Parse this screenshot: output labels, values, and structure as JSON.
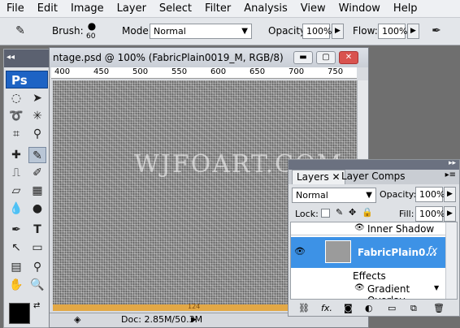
{
  "menu": [
    "File",
    "Edit",
    "Image",
    "Layer",
    "Select",
    "Filter",
    "Analysis",
    "View",
    "Window",
    "Help"
  ],
  "options": {
    "brush_label": "Brush:",
    "brush_size": "60",
    "mode_label": "Mode:",
    "mode_value": "Normal",
    "opacity_label": "Opacity:",
    "opacity_value": "100%",
    "flow_label": "Flow:",
    "flow_value": "100%"
  },
  "toolbox": {
    "logo": "Ps"
  },
  "document": {
    "title": "ntage.psd @ 100% (FabricPlain0019_M, RGB/8)",
    "ruler_ticks": [
      "400",
      "450",
      "500",
      "550",
      "600",
      "650",
      "700",
      "750"
    ],
    "watermark": "WJFOART.COM",
    "bottom_number": "124",
    "status_doc": "Doc: 2.85M/50.3M"
  },
  "layers": {
    "tabs": [
      "Layers",
      "Layer Comps"
    ],
    "blend_mode": "Normal",
    "opacity_label": "Opacity:",
    "opacity_value": "100%",
    "lock_label": "Lock:",
    "fill_label": "Fill:",
    "fill_value": "100%",
    "items": {
      "inner_shadow": "Inner Shadow",
      "layer_name": "FabricPlain0...",
      "fx": "fx",
      "effects": "Effects",
      "gradient_overlay": "Gradient Overlay"
    }
  },
  "colors": {
    "accent": "#3d92e6",
    "ps_blue": "#1d63c4"
  }
}
